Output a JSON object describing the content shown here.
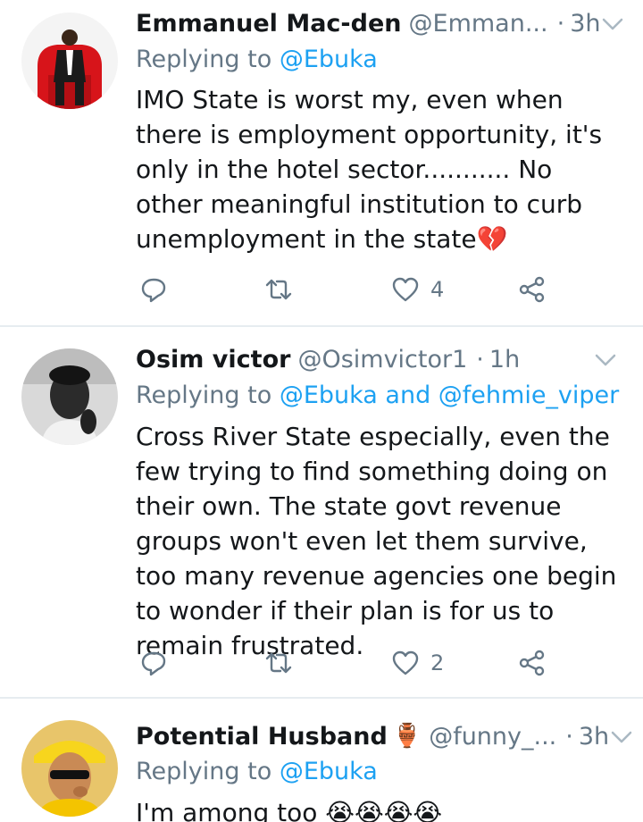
{
  "tweets": [
    {
      "name": "Emmanuel Mac-den",
      "handle": "@Emman...",
      "time": "3h",
      "replying_prefix": "Replying to",
      "mentions": "@Ebuka",
      "text": "IMO State is worst my, even when there is employment opportunity, it's only in the hotel sector........... No other meaningful institution to curb unemployment in the state💔",
      "likes": "4"
    },
    {
      "name": "Osim victor",
      "handle": "@Osimvictor1",
      "time": "1h",
      "replying_prefix": "Replying to",
      "mentions": "@Ebuka and @fehmie_viper",
      "text": "Cross River State especially, even the few trying to find something doing on their own. The state govt revenue groups won't even let them survive, too many revenue agencies one begin to wonder if their plan is for us to remain frustrated.",
      "likes": "2"
    },
    {
      "name": "Potential Husband",
      "name_emoji": "🏺",
      "handle": "@funny_...",
      "time": "3h",
      "replying_prefix": "Replying to",
      "mentions": "@Ebuka",
      "text": "I'm among too 😭😭😭😭"
    }
  ],
  "icons": {
    "reply": "reply-icon",
    "retweet": "retweet-icon",
    "like": "heart-icon",
    "share": "share-icon",
    "more": "chevron-down-icon"
  },
  "colors": {
    "link": "#1da1f2",
    "secondary": "#657786",
    "text": "#14171a",
    "divider": "#e6ecf0"
  }
}
